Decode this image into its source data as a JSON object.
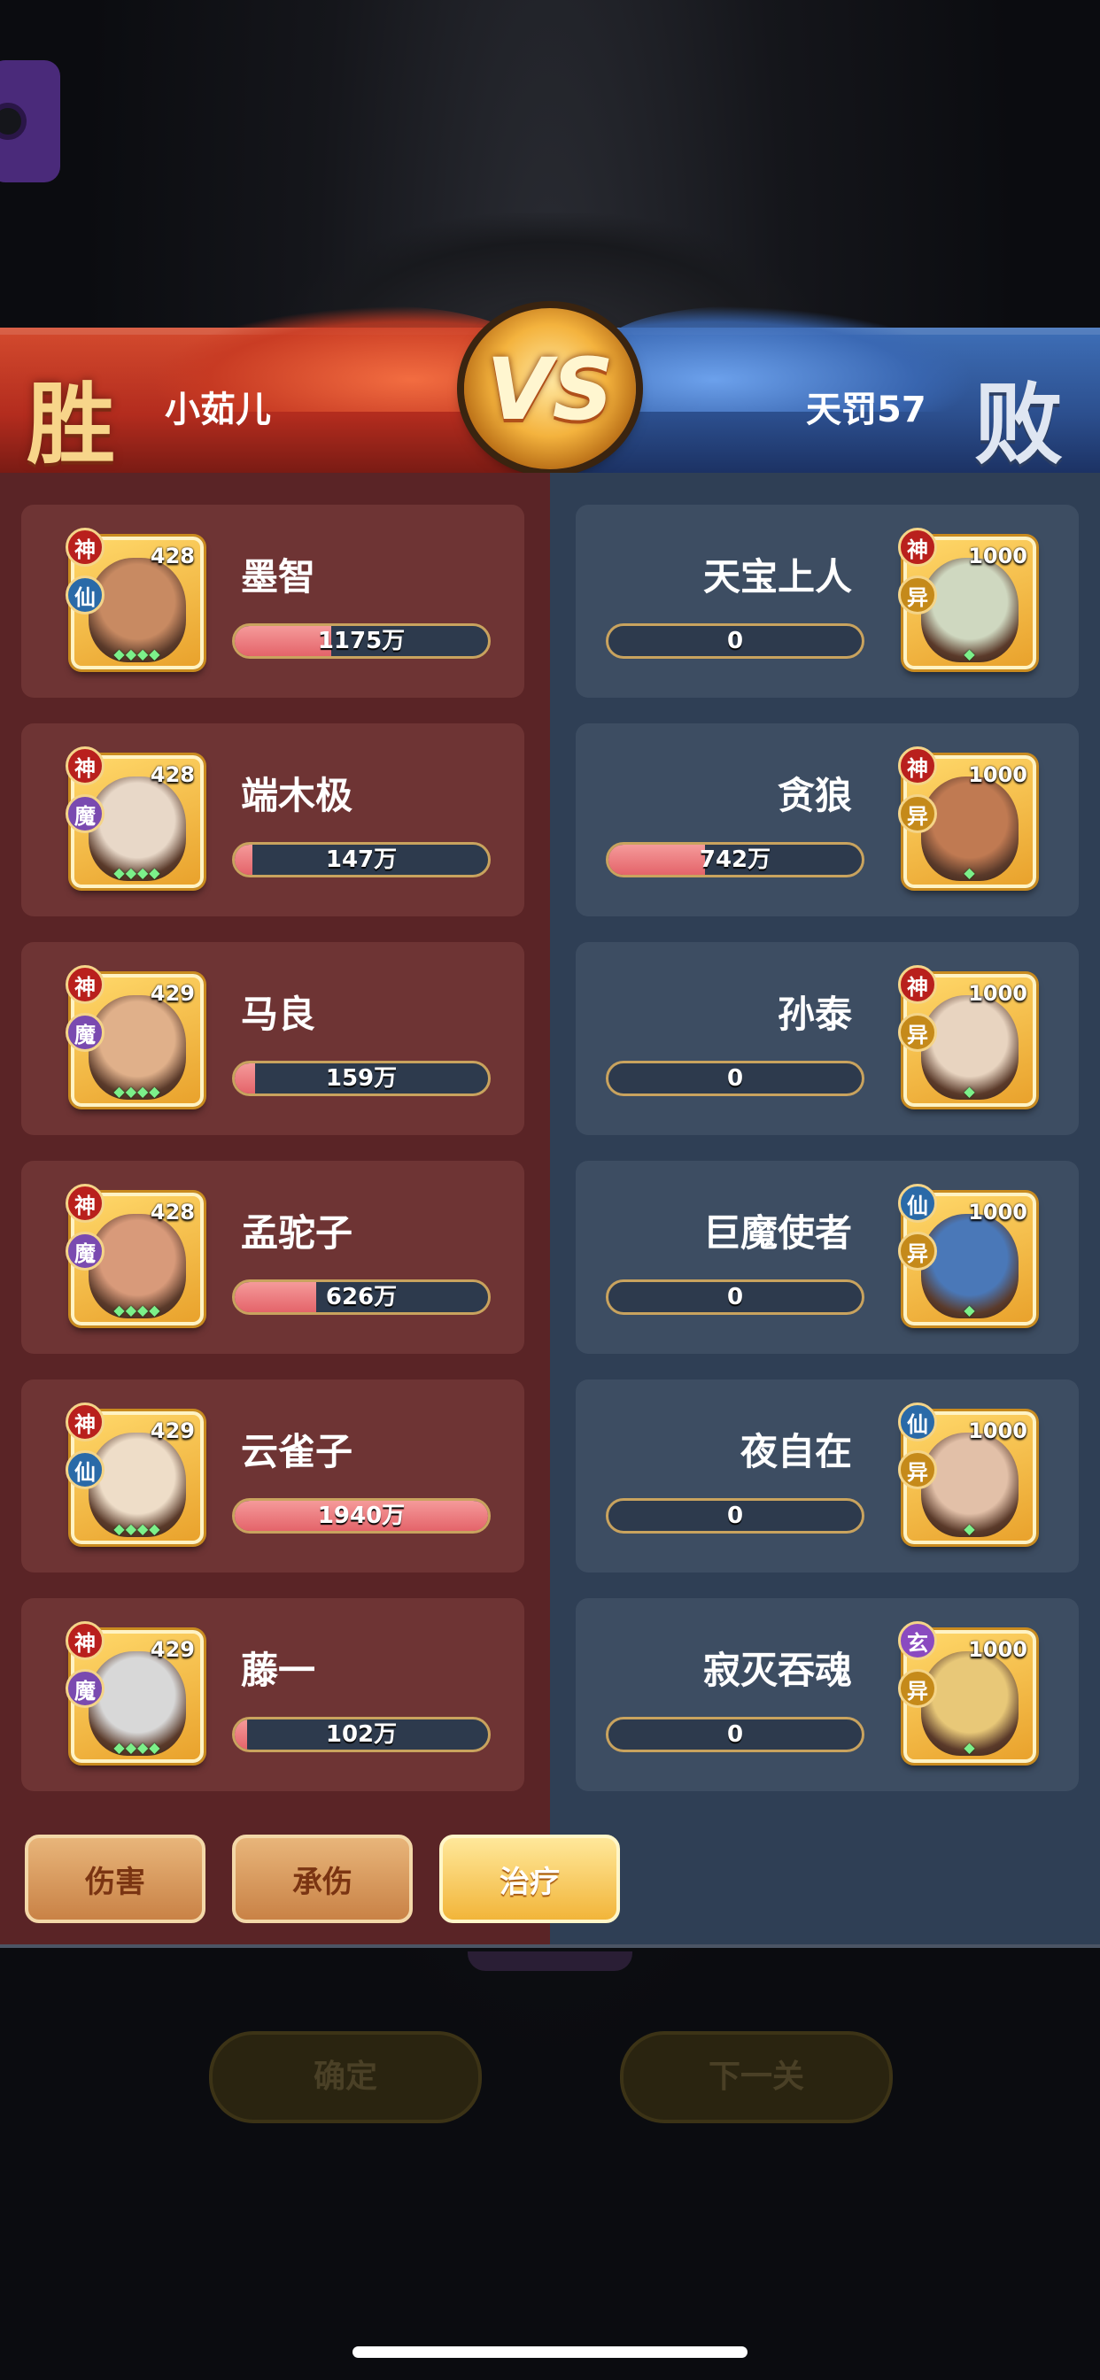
{
  "header": {
    "win_char": "胜",
    "lose_char": "败",
    "vs_text": "VS",
    "left_player": "小茹儿",
    "right_player": "天罚57"
  },
  "left_team": [
    {
      "name": "墨智",
      "level": "428",
      "badge_top": "神",
      "badge_bottom": "仙",
      "value": "1175万",
      "fill": 0.38
    },
    {
      "name": "端木极",
      "level": "428",
      "badge_top": "神",
      "badge_bottom": "魔",
      "value": "147万",
      "fill": 0.07
    },
    {
      "name": "马良",
      "level": "429",
      "badge_top": "神",
      "badge_bottom": "魔",
      "value": "159万",
      "fill": 0.08
    },
    {
      "name": "孟驼子",
      "level": "428",
      "badge_top": "神",
      "badge_bottom": "魔",
      "value": "626万",
      "fill": 0.32
    },
    {
      "name": "云雀子",
      "level": "429",
      "badge_top": "神",
      "badge_bottom": "仙",
      "value": "1940万",
      "fill": 1.0
    },
    {
      "name": "藤一",
      "level": "429",
      "badge_top": "神",
      "badge_bottom": "魔",
      "value": "102万",
      "fill": 0.05
    }
  ],
  "right_team": [
    {
      "name": "天宝上人",
      "level": "1000",
      "badge_top": "神",
      "badge_bottom": "异",
      "value": "0",
      "fill": 0
    },
    {
      "name": "贪狼",
      "level": "1000",
      "badge_top": "神",
      "badge_bottom": "异",
      "value": "742万",
      "fill": 0.38
    },
    {
      "name": "孙泰",
      "level": "1000",
      "badge_top": "神",
      "badge_bottom": "异",
      "value": "0",
      "fill": 0
    },
    {
      "name": "巨魔使者",
      "level": "1000",
      "badge_top": "仙",
      "badge_bottom": "异",
      "value": "0",
      "fill": 0
    },
    {
      "name": "夜自在",
      "level": "1000",
      "badge_top": "仙",
      "badge_bottom": "异",
      "value": "0",
      "fill": 0
    },
    {
      "name": "寂灭吞魂",
      "level": "1000",
      "badge_top": "玄",
      "badge_bottom": "异",
      "value": "0",
      "fill": 0
    }
  ],
  "tabs": [
    {
      "label": "伤害",
      "active": false
    },
    {
      "label": "承伤",
      "active": false
    },
    {
      "label": "治疗",
      "active": true
    }
  ],
  "background_buttons": {
    "confirm": "确定",
    "next": "下一关"
  },
  "stars": {
    "left": "◆◆◆◆",
    "right": "◆"
  },
  "colors": {
    "left_panel": "#5a2426",
    "right_panel": "#2f3f55",
    "bar_fill": "#e4646a",
    "gold_border": "#c9a35e"
  }
}
